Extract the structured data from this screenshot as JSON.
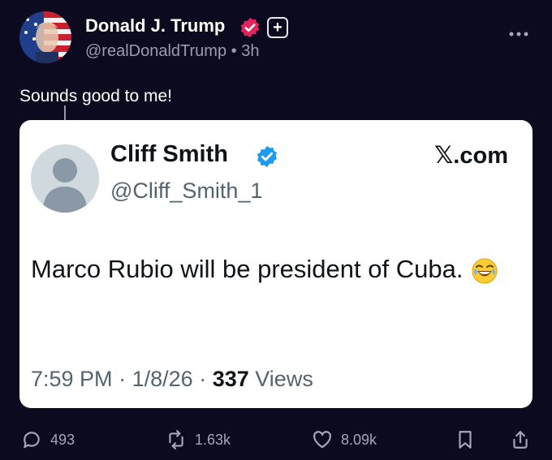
{
  "post": {
    "author_name": "Donald J. Trump",
    "handle": "@realDonaldTrump",
    "separator": "•",
    "time": "3h",
    "text": "Sounds good to me!"
  },
  "quoted": {
    "author_name": "Cliff Smith",
    "handle": "@Cliff_Smith_1",
    "source": "𝕏.com",
    "text": "Marco Rubio will be president of Cuba.",
    "time": "7:59 PM",
    "date": "1/8/26",
    "views_count": "337",
    "views_label": "Views"
  },
  "actions": {
    "replies": "493",
    "reposts": "1.63k",
    "likes": "8.09k"
  },
  "colors": {
    "background": "#0b0a1e",
    "verified_pink": "#e0245e",
    "verified_blue": "#1d9bf0"
  },
  "icons": [
    "avatar",
    "verified-badge-icon",
    "plus-badge-icon",
    "more-icon",
    "reply-icon",
    "repost-icon",
    "like-icon",
    "bookmark-icon",
    "share-icon",
    "laughing-emoji-icon"
  ]
}
